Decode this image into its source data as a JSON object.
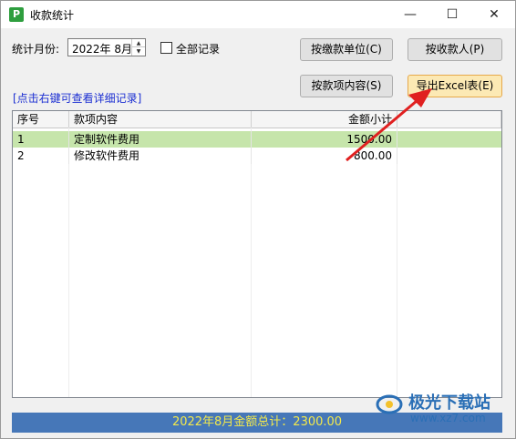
{
  "window": {
    "title": "收款统计",
    "app_icon_letter": "P",
    "minimize_glyph": "—",
    "maximize_glyph": "☐",
    "close_glyph": "✕"
  },
  "filters": {
    "month_label": "统计月份:",
    "month_value": "2022年  8月",
    "all_records_label": "全部记录",
    "all_records_checked": false
  },
  "buttons": {
    "by_payer_unit": "按缴款单位(C)",
    "by_payee": "按收款人(P)",
    "by_item": "按款项内容(S)",
    "export_excel": "导出Excel表(E)"
  },
  "hint": "[点击右键可查看详细记录]",
  "table": {
    "columns": [
      "序号",
      "款项内容",
      "金额小计"
    ],
    "rows": [
      {
        "no": "1",
        "item": "定制软件费用",
        "amount": "1500.00",
        "selected": true
      },
      {
        "no": "2",
        "item": "修改软件费用",
        "amount": "800.00",
        "selected": false
      }
    ]
  },
  "status": {
    "total_text": "2022年8月金额总计：2300.00"
  },
  "watermark": {
    "name": "极光下载站",
    "url": "www.xz7.com"
  },
  "colors": {
    "selected_row": "#c6e5ab",
    "status_bg": "#4677b8",
    "status_text": "#f3e94b",
    "hint_text": "#1c2fd2",
    "annotation_arrow": "#e02020"
  },
  "icons": {
    "app": "app-p-icon",
    "annotation": "red-arrow-annotation"
  }
}
